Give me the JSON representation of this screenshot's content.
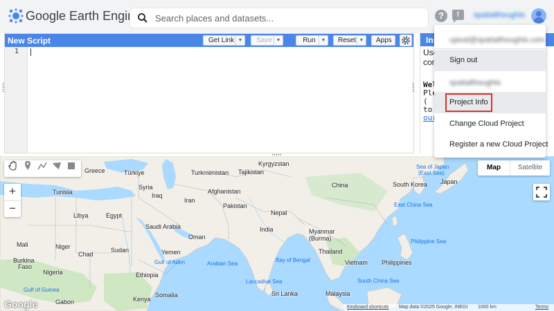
{
  "app": {
    "title": "Google Earth Engine"
  },
  "search": {
    "placeholder": "Search places and datasets..."
  },
  "header": {
    "help_icon": "question-mark-icon",
    "feedback_icon": "feedback-icon",
    "user_name": "spatialthoughts"
  },
  "editor": {
    "script_title": "New Script",
    "buttons": {
      "get_link": "Get Link",
      "save": "Save",
      "run": "Run",
      "reset": "Reset",
      "apps": "Apps"
    },
    "line_numbers": [
      "1"
    ]
  },
  "inspector": {
    "tab_label": "Ins",
    "lines": [
      "Use",
      "con",
      "Wel",
      "Ple",
      "(",
      "to",
      "our"
    ]
  },
  "user_menu": {
    "email": "ujaval@spatialthoughts.com",
    "sign_out": "Sign out",
    "user_label": "spatialthoughts",
    "project_info": "Project Info",
    "change_cloud_project": "Change Cloud Project",
    "register_cloud_project": "Register a new Cloud Project"
  },
  "map": {
    "type_map": "Map",
    "type_satellite": "Satellite",
    "zoom_in": "+",
    "zoom_out": "−",
    "google": "Google",
    "attribution": {
      "shortcuts": "Keyboard shortcuts",
      "data": "Map data ©2025 Google, INEGI",
      "scale": "1000 km",
      "terms": "Terms"
    },
    "countries": {
      "greece": "Greece",
      "turkiye": "Türkiye",
      "turkmenistan": "Turkmenistan",
      "kyrgyzstan": "Kyrgyzstan",
      "tajikistan": "Tajikistan",
      "tunisia": "Tunisia",
      "syria": "Syria",
      "afghanistan": "Afghanistan",
      "china": "China",
      "south_korea": "South Korea",
      "japan": "Japan",
      "iraq": "Iraq",
      "iran": "Iran",
      "pakistan": "Pakistan",
      "libya": "Libya",
      "egypt": "Egypt",
      "nepal": "Nepal",
      "saudi_arabia": "Saudi Arabia",
      "india": "India",
      "oman": "Oman",
      "myanmar": "Myanmar",
      "burma": "(Burma)",
      "mali": "Mali",
      "niger": "Niger",
      "sudan": "Sudan",
      "chad": "Chad",
      "yemen": "Yemen",
      "burkina_faso_1": "Burkina",
      "burkina_faso_2": "Faso",
      "thailand": "Thailand",
      "vietnam": "Vietnam",
      "philippines": "Philippines",
      "nigeria": "Nigeria",
      "ethiopia": "Ethiopia",
      "sri_lanka": "Sri Lanka",
      "malaysia": "Malaysia",
      "kenya": "Kenya",
      "gabon": "Gabon",
      "somalia": "Somalia"
    },
    "seas": {
      "sea_of_japan_1": "Sea of Japan",
      "sea_of_japan_2": "(East Sea)",
      "east_china_sea": "East China Sea",
      "gulf_of_aden": "Gulf of Aden",
      "arabian_sea": "Arabian Sea",
      "bay_of_bengal": "Bay of Bengal",
      "philippine_sea": "Philippine Sea",
      "laccadive_sea": "Laccadive Sea",
      "south_china_sea": "South China Sea",
      "gulf_of_guinea": "Gulf of Guinea"
    }
  },
  "colors": {
    "header_blue": "#4a86e8",
    "land": "#f2efe9",
    "water": "#aadaff",
    "highlight_red": "#d93025",
    "link_blue": "#1a73e8"
  }
}
